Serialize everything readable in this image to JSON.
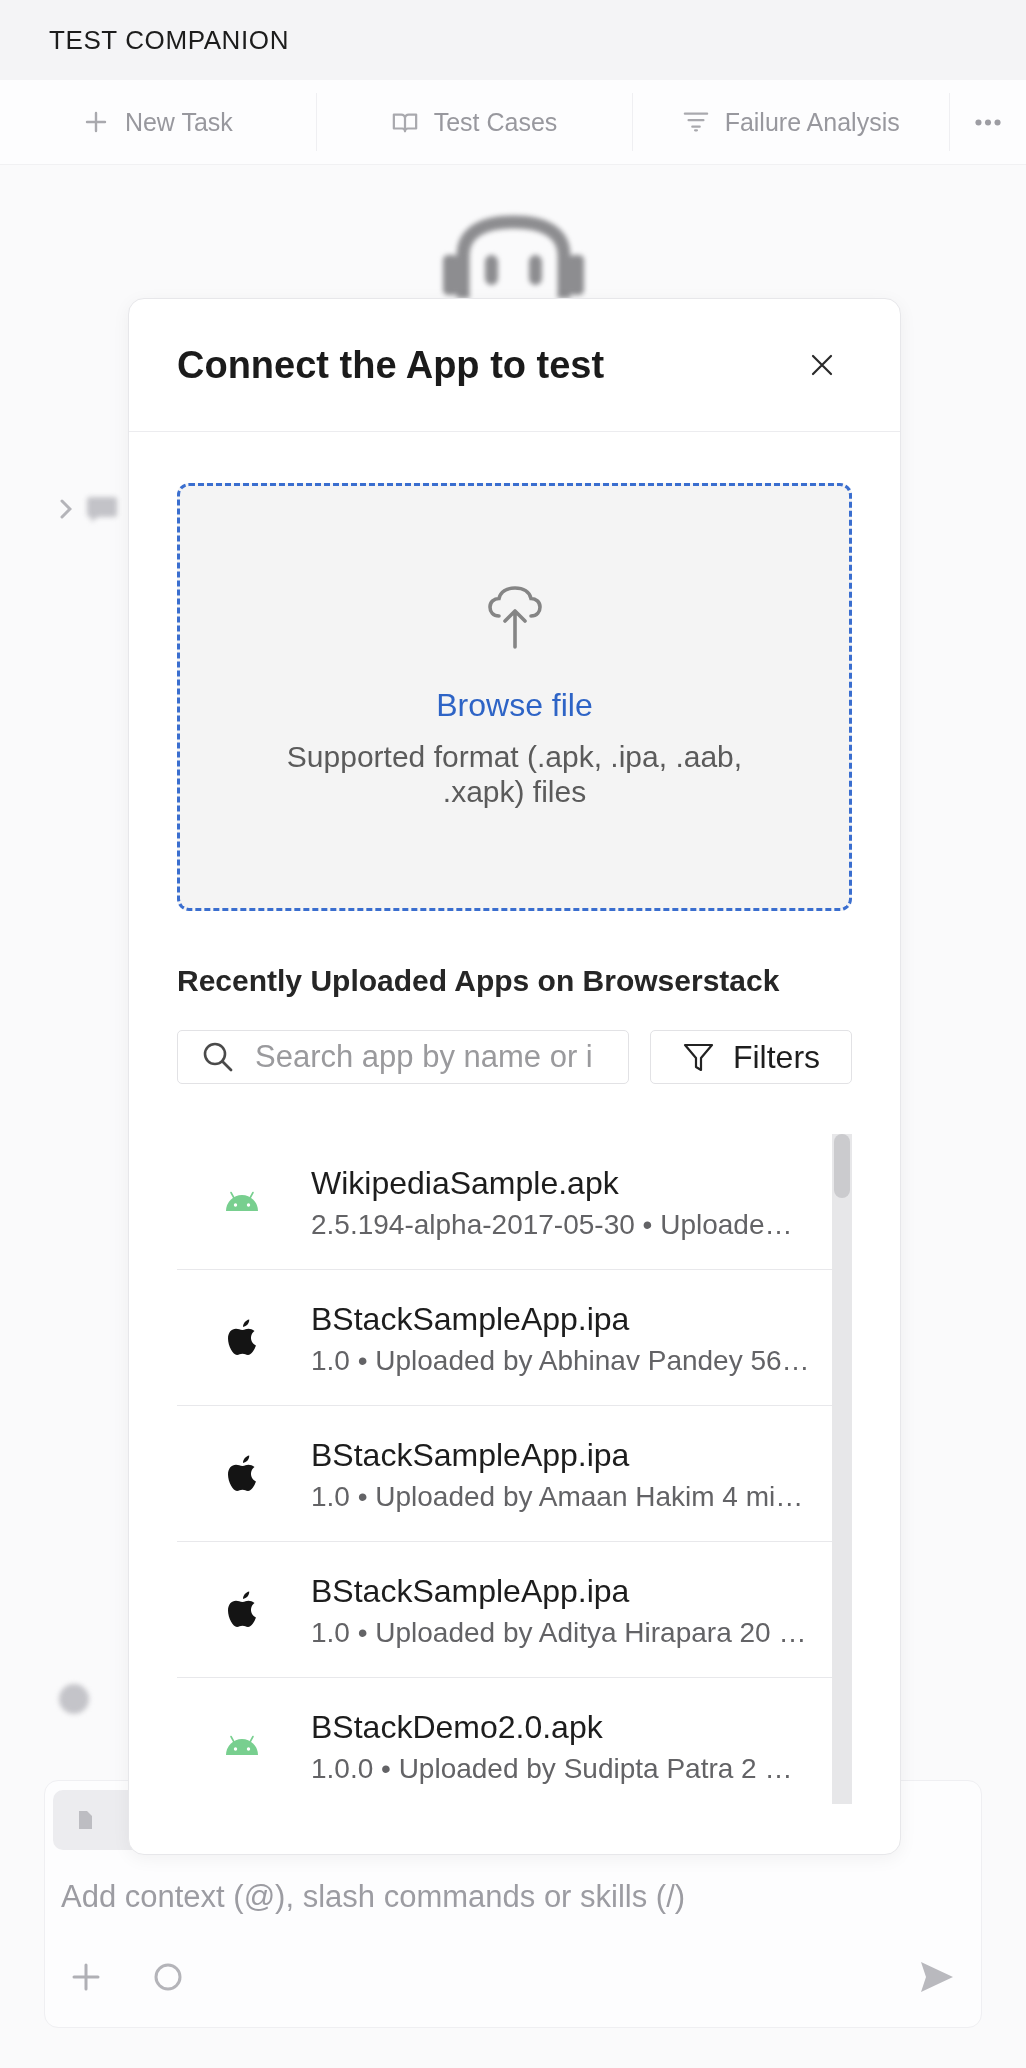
{
  "header": {
    "title": "TEST COMPANION"
  },
  "toolbar": {
    "buttons": [
      {
        "label": "New Task"
      },
      {
        "label": "Test Cases"
      },
      {
        "label": "Failure Analysis"
      }
    ]
  },
  "composer": {
    "placeholder": "Add context (@), slash commands or skills (/)"
  },
  "modal": {
    "title": "Connect the App to test",
    "upload": {
      "link": "Browse file",
      "hint": "Supported format (.apk, .ipa, .aab, .xapk) files"
    },
    "recent_heading": "Recently Uploaded Apps on Browserstack",
    "search": {
      "placeholder": "Search app by name or i"
    },
    "filter_button": "Filters",
    "apps": [
      {
        "kind": "android",
        "name": "WikipediaSample.apk",
        "details": "2.5.194-alpha-2017-05-30 • Uploade…",
        "selected": false
      },
      {
        "kind": "ios",
        "name": "BStackSampleApp.ipa",
        "details": "1.0 • Uploaded by Abhinav Pandey 56…",
        "selected": false
      },
      {
        "kind": "ios",
        "name": "BStackSampleApp.ipa",
        "details": "1.0 • Uploaded by Amaan Hakim 4 mi…",
        "selected": false
      },
      {
        "kind": "ios",
        "name": "BStackSampleApp.ipa",
        "details": "1.0 • Uploaded by Aditya Hirapara 20 …",
        "selected": false
      },
      {
        "kind": "android",
        "name": "BStackDemo2.0.apk",
        "details": "1.0.0 • Uploaded by Sudipta Patra 2 …",
        "selected": false
      }
    ]
  }
}
